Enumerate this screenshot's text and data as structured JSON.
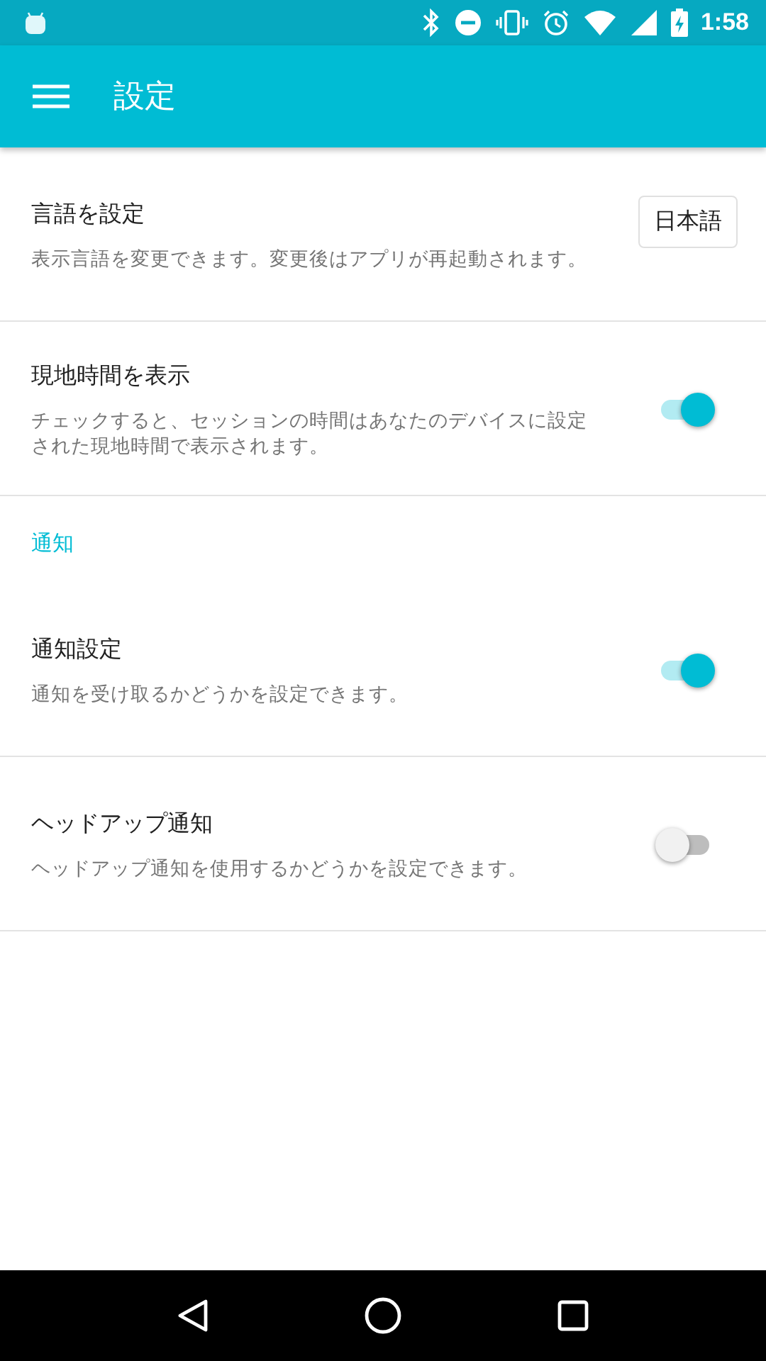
{
  "status_bar": {
    "time": "1:58"
  },
  "app_bar": {
    "title": "設定"
  },
  "items": [
    {
      "kind": "button",
      "title": "言語を設定",
      "description": "表示言語を変更できます。変更後はアプリが再起動されます。",
      "button_label": "日本語"
    },
    {
      "kind": "switch",
      "title": "現地時間を表示",
      "description": "チェックすると、セッションの時間はあなたのデバイスに設定された現地時間で表示されます。",
      "on": true
    },
    {
      "kind": "header",
      "title": "通知"
    },
    {
      "kind": "switch",
      "title": "通知設定",
      "description": "通知を受け取るかどうかを設定できます。",
      "on": true
    },
    {
      "kind": "switch",
      "title": "ヘッドアップ通知",
      "description": "ヘッドアップ通知を使用するかどうかを設定できます。",
      "on": false
    }
  ]
}
